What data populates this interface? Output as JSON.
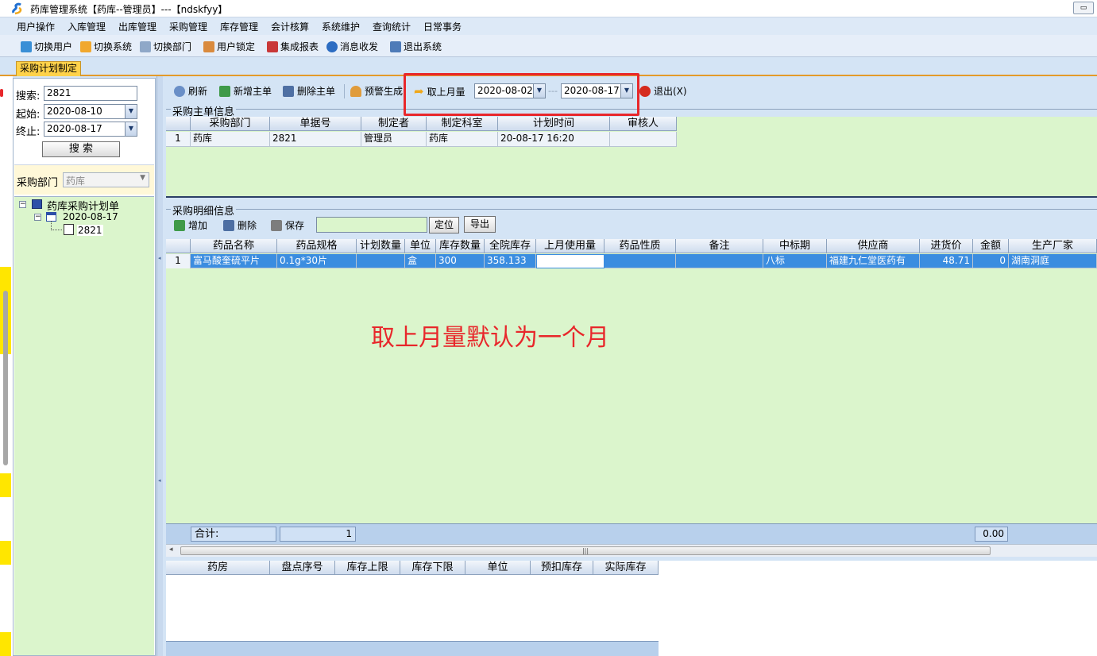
{
  "window": {
    "title": "药库管理系统【药库--管理员】---【ndskfyy】",
    "restore_btn": "▭"
  },
  "menu": [
    "用户操作",
    "入库管理",
    "出库管理",
    "采购管理",
    "库存管理",
    "会计核算",
    "系统维护",
    "查询统计",
    "日常事务"
  ],
  "toolbar": [
    "切换用户",
    "切换系统",
    "切换部门",
    "用户锁定",
    "集成报表",
    "消息收发",
    "退出系统"
  ],
  "tab": "采购计划制定",
  "left": {
    "search_label": "搜索:",
    "search_value": "2821",
    "start_label": "起始:",
    "start_value": "2020-08-10",
    "end_label": "终止:",
    "end_value": "2020-08-17",
    "search_btn": "搜  索",
    "dept_label": "采购部门",
    "dept_value": "药库",
    "tree": {
      "root": "药库采购计划单",
      "date_node": "2020-08-17",
      "doc_node": "2821"
    }
  },
  "rtoolbar": {
    "refresh": "刷新",
    "add_master": "新增主单",
    "delete_master": "删除主单",
    "alert_gen": "预警生成",
    "last_month": "取上月量",
    "date_from": "2020-08-02",
    "date_sep": "---",
    "date_to": "2020-08-17",
    "exit": "退出(X)"
  },
  "master": {
    "caption": "采购主单信息",
    "headers": [
      "采购部门",
      "单据号",
      "制定者",
      "制定科室",
      "计划时间",
      "审核人"
    ],
    "rows": [
      [
        "1",
        "药库",
        "2821",
        "管理员",
        "药库",
        "20-08-17 16:20",
        ""
      ]
    ]
  },
  "detail": {
    "caption": "采购明细信息",
    "add": "增加",
    "delete": "删除",
    "save": "保存",
    "locate": "定位",
    "export": "导出",
    "headers": [
      "药品名称",
      "药品规格",
      "计划数量",
      "单位",
      "库存数量",
      "全院库存",
      "上月使用量",
      "药品性质",
      "备注",
      "中标期",
      "供应商",
      "进货价",
      "金额",
      "生产厂家"
    ],
    "rows": [
      [
        "1",
        "富马酸奎硫平片",
        "0.1g*30片",
        "",
        "盒",
        "300",
        "358.133",
        "",
        "",
        "",
        "八标",
        "福建九仁堂医药有",
        "48.71",
        "0",
        "湖南洞庭"
      ]
    ],
    "total_label": "合计:",
    "total_count": "1",
    "total_amount": "0.00"
  },
  "pharmacy": {
    "headers": [
      "药房",
      "盘点序号",
      "库存上限",
      "库存下限",
      "单位",
      "预扣库存",
      "实际库存"
    ]
  },
  "annotation": "取上月量默认为一个月"
}
